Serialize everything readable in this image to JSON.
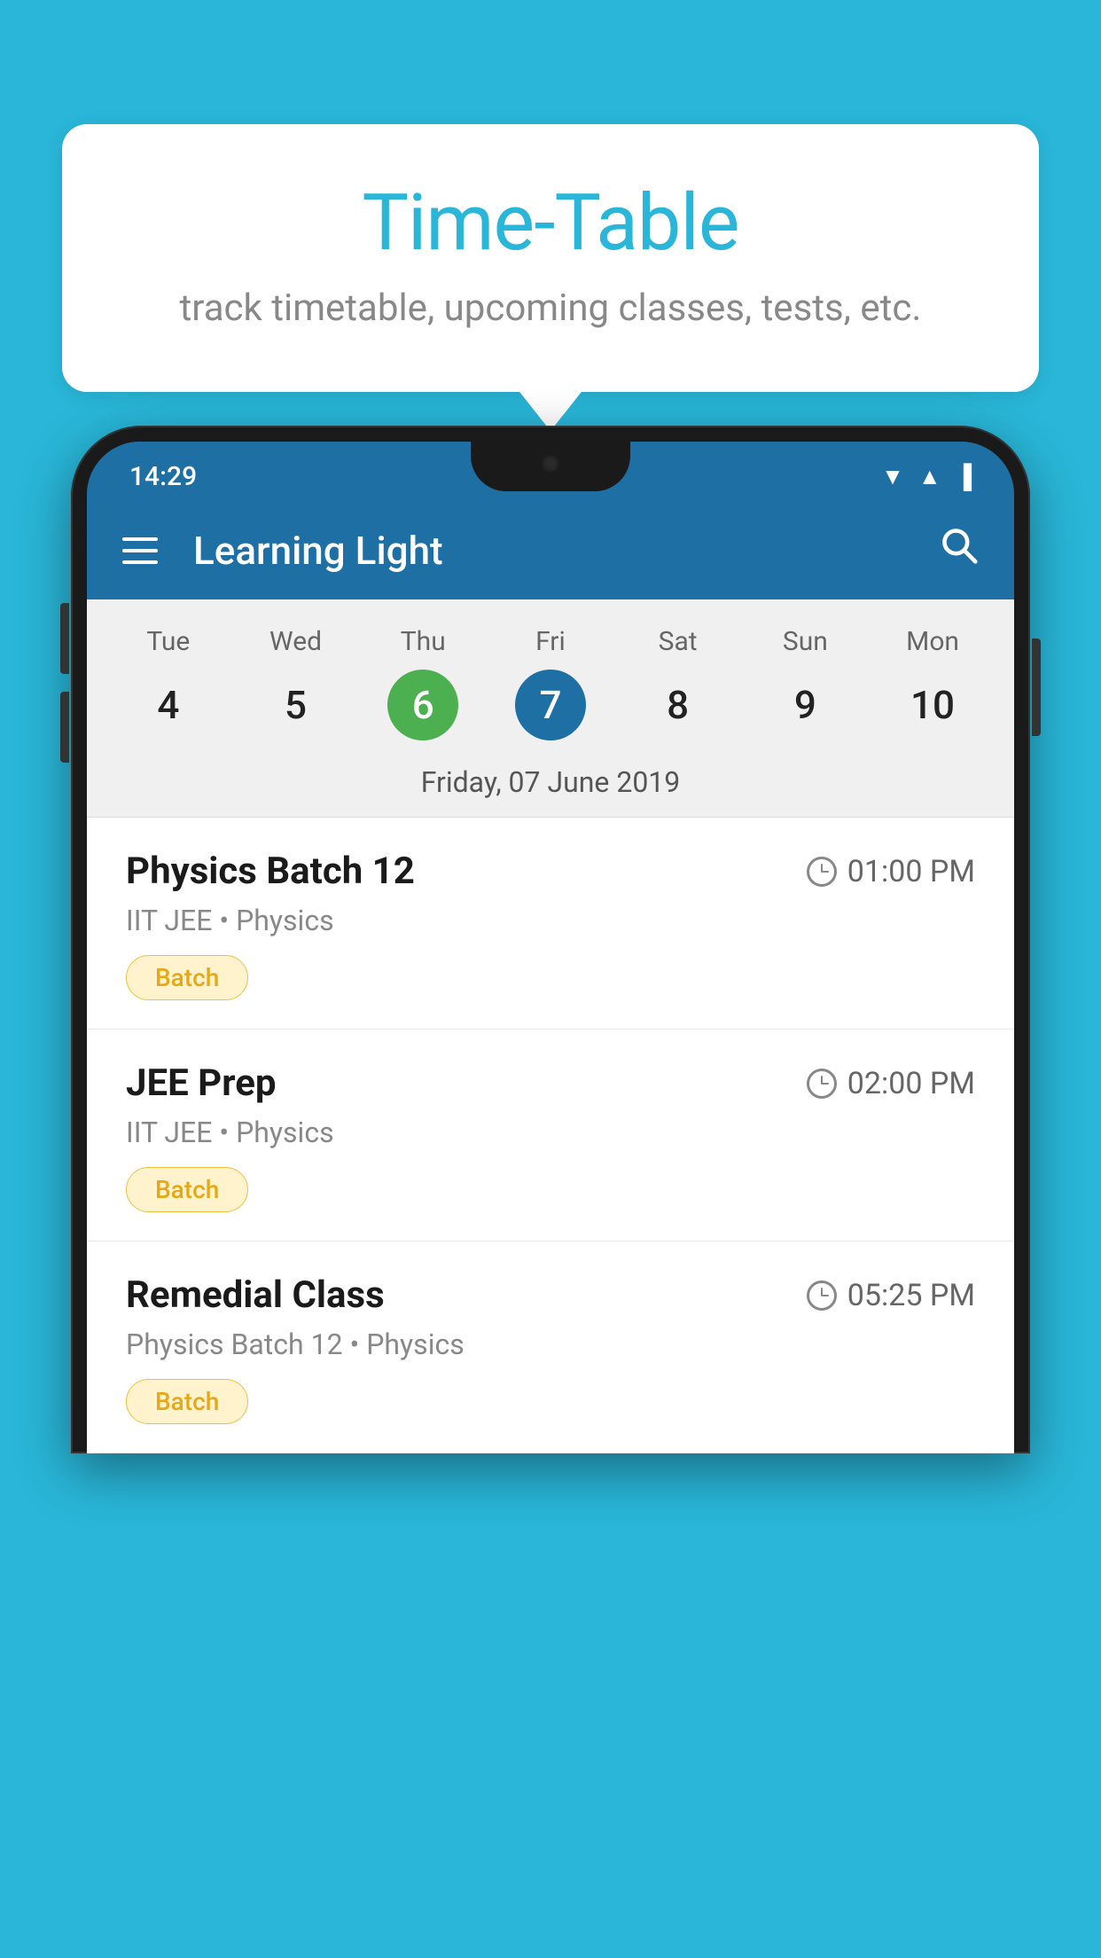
{
  "background_color": "#29B6D8",
  "bubble": {
    "title": "Time-Table",
    "subtitle": "track timetable, upcoming classes, tests, etc."
  },
  "status_bar": {
    "time": "14:29"
  },
  "app_bar": {
    "title": "Learning Light"
  },
  "calendar": {
    "days": [
      {
        "name": "Tue",
        "number": "4",
        "state": "normal"
      },
      {
        "name": "Wed",
        "number": "5",
        "state": "normal"
      },
      {
        "name": "Thu",
        "number": "6",
        "state": "today"
      },
      {
        "name": "Fri",
        "number": "7",
        "state": "selected"
      },
      {
        "name": "Sat",
        "number": "8",
        "state": "normal"
      },
      {
        "name": "Sun",
        "number": "9",
        "state": "normal"
      },
      {
        "name": "Mon",
        "number": "10",
        "state": "normal"
      }
    ],
    "selected_date_label": "Friday, 07 June 2019"
  },
  "schedule": {
    "items": [
      {
        "title": "Physics Batch 12",
        "time": "01:00 PM",
        "subtitle": "IIT JEE • Physics",
        "badge": "Batch"
      },
      {
        "title": "JEE Prep",
        "time": "02:00 PM",
        "subtitle": "IIT JEE • Physics",
        "badge": "Batch"
      },
      {
        "title": "Remedial Class",
        "time": "05:25 PM",
        "subtitle": "Physics Batch 12 • Physics",
        "badge": "Batch"
      }
    ]
  }
}
